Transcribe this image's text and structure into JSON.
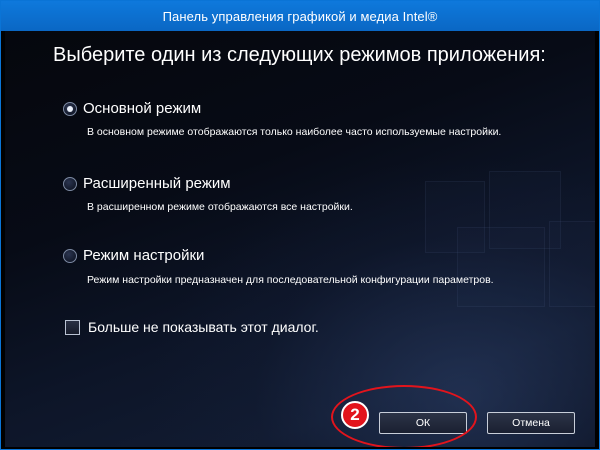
{
  "window": {
    "title": "Панель управления графикой и медиа Intel®"
  },
  "dialog": {
    "heading": "Выберите один из следующих режимов приложения:",
    "options": [
      {
        "label": "Основной режим",
        "description": "В основном режиме отображаются только наиболее часто используемые настройки.",
        "selected": true
      },
      {
        "label": "Расширенный режим",
        "description": "В расширенном режиме отображаются все настройки.",
        "selected": false
      },
      {
        "label": "Режим настройки",
        "description": "Режим настройки предназначен для последовательной конфигурации параметров.",
        "selected": false
      }
    ],
    "dont_show_again": {
      "label": "Больше не показывать этот диалог.",
      "checked": false
    },
    "buttons": {
      "ok": "ОК",
      "cancel": "Отмена"
    }
  },
  "annotation": {
    "step_number": "2",
    "color": "#e2141c"
  },
  "colors": {
    "titlebar": "#0a6fd0",
    "background": "#070b16"
  }
}
